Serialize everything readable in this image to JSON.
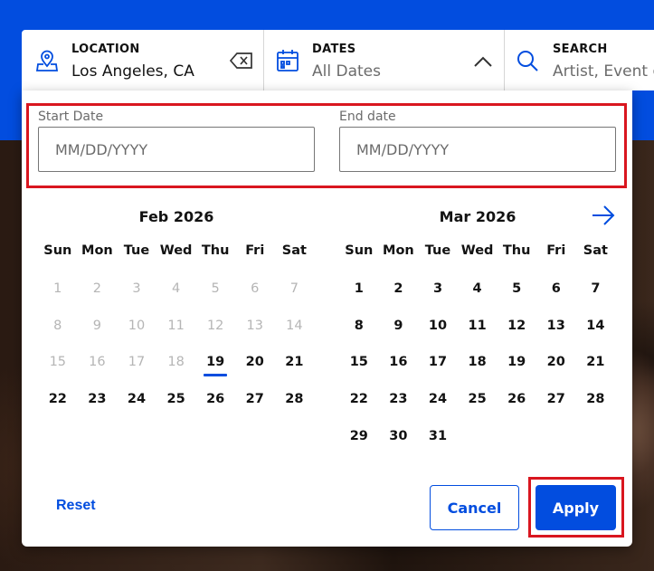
{
  "colors": {
    "brand": "#024ddf",
    "highlight": "#d9161f",
    "muted": "#6b6b6b",
    "disabled": "#b5b5b5"
  },
  "search_bar": {
    "location": {
      "label": "LOCATION",
      "value": "Los Angeles, CA",
      "icon": "location-pin-icon",
      "clear_icon": "backspace-clear-icon"
    },
    "dates": {
      "label": "DATES",
      "value": "All Dates",
      "icon": "calendar-icon",
      "chevron_icon": "chevron-up-icon"
    },
    "search": {
      "label": "SEARCH",
      "value": "Artist, Event or Venue",
      "icon": "search-icon"
    }
  },
  "date_range": {
    "start": {
      "label": "Start Date",
      "placeholder": "MM/DD/YYYY"
    },
    "end": {
      "label": "End date",
      "placeholder": "MM/DD/YYYY"
    }
  },
  "weekdays": [
    "Sun",
    "Mon",
    "Tue",
    "Wed",
    "Thu",
    "Fri",
    "Sat"
  ],
  "calendars": [
    {
      "title": "Feb 2026",
      "weeks": [
        [
          {
            "d": "1",
            "past": true
          },
          {
            "d": "2",
            "past": true
          },
          {
            "d": "3",
            "past": true
          },
          {
            "d": "4",
            "past": true
          },
          {
            "d": "5",
            "past": true
          },
          {
            "d": "6",
            "past": true
          },
          {
            "d": "7",
            "past": true
          }
        ],
        [
          {
            "d": "8",
            "past": true
          },
          {
            "d": "9",
            "past": true
          },
          {
            "d": "10",
            "past": true
          },
          {
            "d": "11",
            "past": true
          },
          {
            "d": "12",
            "past": true
          },
          {
            "d": "13",
            "past": true
          },
          {
            "d": "14",
            "past": true
          }
        ],
        [
          {
            "d": "15",
            "past": true
          },
          {
            "d": "16",
            "past": true
          },
          {
            "d": "17",
            "past": true
          },
          {
            "d": "18",
            "past": true
          },
          {
            "d": "19",
            "today": true
          },
          {
            "d": "20"
          },
          {
            "d": "21"
          }
        ],
        [
          {
            "d": "22"
          },
          {
            "d": "23"
          },
          {
            "d": "24"
          },
          {
            "d": "25"
          },
          {
            "d": "26"
          },
          {
            "d": "27"
          },
          {
            "d": "28"
          }
        ]
      ]
    },
    {
      "title": "Mar 2026",
      "weeks": [
        [
          {
            "d": "1"
          },
          {
            "d": "2"
          },
          {
            "d": "3"
          },
          {
            "d": "4"
          },
          {
            "d": "5"
          },
          {
            "d": "6"
          },
          {
            "d": "7"
          }
        ],
        [
          {
            "d": "8"
          },
          {
            "d": "9"
          },
          {
            "d": "10"
          },
          {
            "d": "11"
          },
          {
            "d": "12"
          },
          {
            "d": "13"
          },
          {
            "d": "14"
          }
        ],
        [
          {
            "d": "15"
          },
          {
            "d": "16"
          },
          {
            "d": "17"
          },
          {
            "d": "18"
          },
          {
            "d": "19"
          },
          {
            "d": "20"
          },
          {
            "d": "21"
          }
        ],
        [
          {
            "d": "22"
          },
          {
            "d": "23"
          },
          {
            "d": "24"
          },
          {
            "d": "25"
          },
          {
            "d": "26"
          },
          {
            "d": "27"
          },
          {
            "d": "28"
          }
        ],
        [
          {
            "d": "29"
          },
          {
            "d": "30"
          },
          {
            "d": "31"
          },
          {
            "d": ""
          },
          {
            "d": ""
          },
          {
            "d": ""
          },
          {
            "d": ""
          }
        ]
      ]
    }
  ],
  "navigation": {
    "next_icon": "arrow-right-icon"
  },
  "actions": {
    "reset": "Reset",
    "cancel": "Cancel",
    "apply": "Apply"
  }
}
